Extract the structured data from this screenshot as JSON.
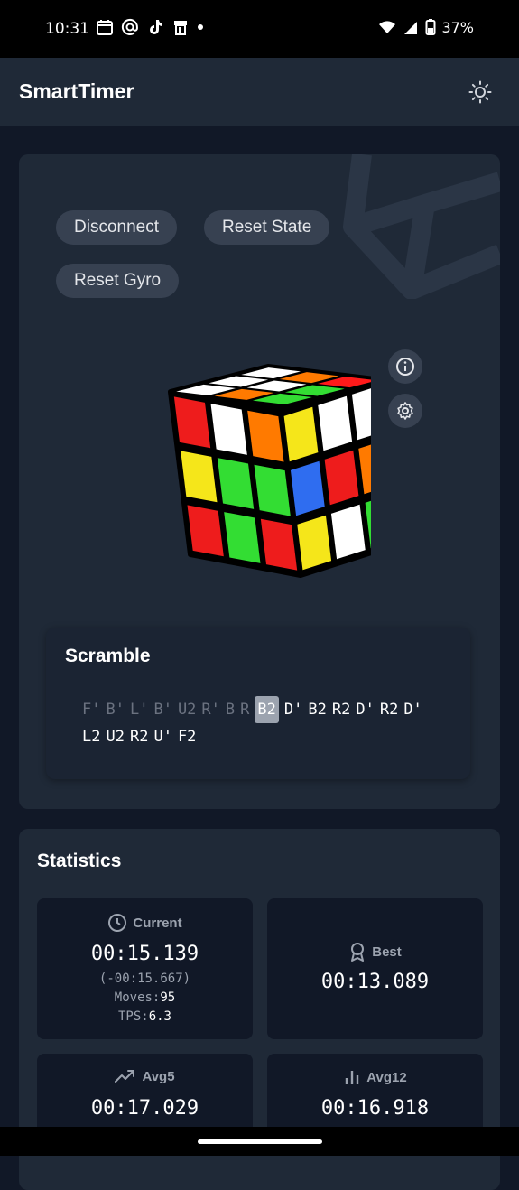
{
  "status": {
    "time": "10:31",
    "battery": "37%"
  },
  "app": {
    "title": "SmartTimer"
  },
  "controls": {
    "disconnect": "Disconnect",
    "reset_state": "Reset State",
    "reset_gyro": "Reset Gyro"
  },
  "scramble": {
    "label": "Scramble",
    "moves": [
      {
        "m": "F'",
        "s": "done"
      },
      {
        "m": "B'",
        "s": "done"
      },
      {
        "m": "L'",
        "s": "done"
      },
      {
        "m": "B'",
        "s": "done"
      },
      {
        "m": "U2",
        "s": "done"
      },
      {
        "m": "R'",
        "s": "done"
      },
      {
        "m": "B",
        "s": "done"
      },
      {
        "m": "R",
        "s": "done"
      },
      {
        "m": "B2",
        "s": "current"
      },
      {
        "m": "D'",
        "s": "todo"
      },
      {
        "m": "B2",
        "s": "todo"
      },
      {
        "m": "R2",
        "s": "todo"
      },
      {
        "m": "D'",
        "s": "todo"
      },
      {
        "m": "R2",
        "s": "todo"
      },
      {
        "m": "D'",
        "s": "todo"
      },
      {
        "m": "L2",
        "s": "todo"
      },
      {
        "m": "U2",
        "s": "todo"
      },
      {
        "m": "R2",
        "s": "todo"
      },
      {
        "m": "U'",
        "s": "todo"
      },
      {
        "m": "F2",
        "s": "todo"
      }
    ]
  },
  "cube": {
    "top": [
      [
        "#ffffff",
        "#ff7a00",
        "#ff1a1a"
      ],
      [
        "#ffffff",
        "#ffffff",
        "#33dd33"
      ],
      [
        "#ffffff",
        "#ff7a00",
        "#33dd33"
      ]
    ],
    "left": [
      [
        "#ee1c1c",
        "#ffffff",
        "#ff7a00"
      ],
      [
        "#f5e61a",
        "#33dd33",
        "#33dd33"
      ],
      [
        "#ee1c1c",
        "#33dd33",
        "#ee1c1c"
      ]
    ],
    "right": [
      [
        "#f5e61a",
        "#ffffff",
        "#ffffff"
      ],
      [
        "#2f6df0",
        "#ee1c1c",
        "#ff7a00"
      ],
      [
        "#f5e61a",
        "#ffffff",
        "#33dd33"
      ]
    ]
  },
  "stats": {
    "title": "Statistics",
    "current": {
      "label": "Current",
      "value": "00:15.139",
      "delta": "(-00:15.667)",
      "moves_label": "Moves:",
      "moves": "95",
      "tps_label": "TPS:",
      "tps": "6.3"
    },
    "best": {
      "label": "Best",
      "value": "00:13.089"
    },
    "avg5": {
      "label": "Avg5",
      "value": "00:17.029"
    },
    "avg12": {
      "label": "Avg12",
      "value": "00:16.918"
    }
  },
  "colors": {
    "bg": "#111827",
    "card": "#1f2937",
    "chip": "#374151",
    "delta_green": "#22c55e"
  }
}
